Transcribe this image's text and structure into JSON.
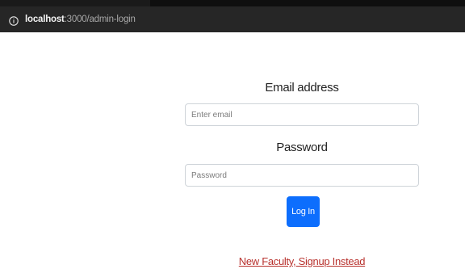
{
  "browser": {
    "url_host": "localhost",
    "url_path": ":3000/admin-login",
    "info_icon": "info-circle-icon"
  },
  "login_form": {
    "email_label": "Email address",
    "email_placeholder": "Enter email",
    "email_value": "",
    "password_label": "Password",
    "password_placeholder": "Password",
    "password_value": "",
    "submit_label": "Log In",
    "signup_link": "New Faculty, Signup Instead"
  },
  "colors": {
    "primary_button": "#0d6efd",
    "link": "#b8322e",
    "address_bar": "#262626"
  }
}
